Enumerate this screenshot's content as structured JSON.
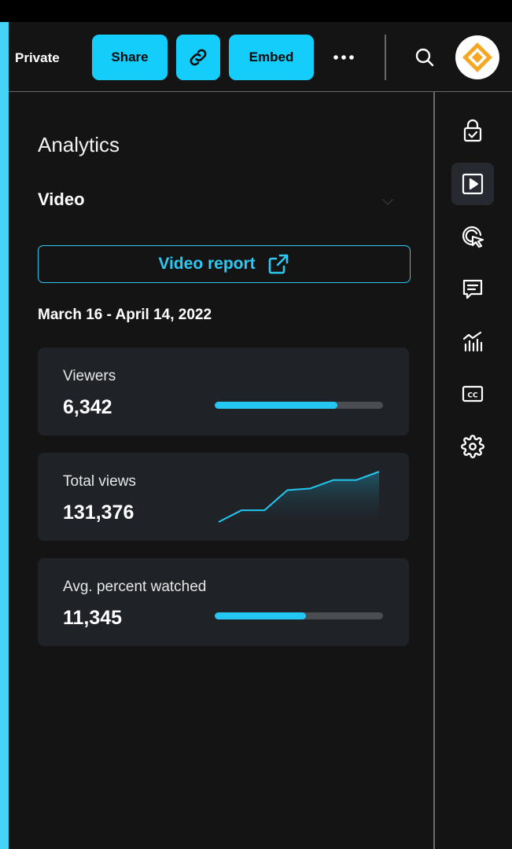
{
  "header": {
    "privacy_label": "Private",
    "share_label": "Share",
    "embed_label": "Embed",
    "accent_color": "#14cdfb"
  },
  "panel": {
    "title": "Analytics",
    "section": "Video",
    "report_button": "Video report",
    "date_range": "March 16 - April 14, 2022",
    "cards": [
      {
        "label": "Viewers",
        "value": "6,342",
        "bar_fill_fraction": 0.73
      },
      {
        "label": "Total views",
        "value": "131,376"
      },
      {
        "label": "Avg. percent watched",
        "value": "11,345",
        "bar_fill_fraction": 0.54
      }
    ]
  },
  "rail": {
    "items": [
      "lock-check-icon",
      "play-icon",
      "click-cursor-icon",
      "comments-icon",
      "analytics-chart-icon",
      "closed-captions-icon",
      "settings-gear-icon"
    ],
    "active": "play-icon"
  },
  "chart_data": {
    "type": "area",
    "x": [
      0,
      1,
      2,
      3,
      4,
      5,
      6,
      7
    ],
    "y": [
      0,
      14,
      14,
      38,
      40,
      50,
      50,
      60
    ]
  }
}
